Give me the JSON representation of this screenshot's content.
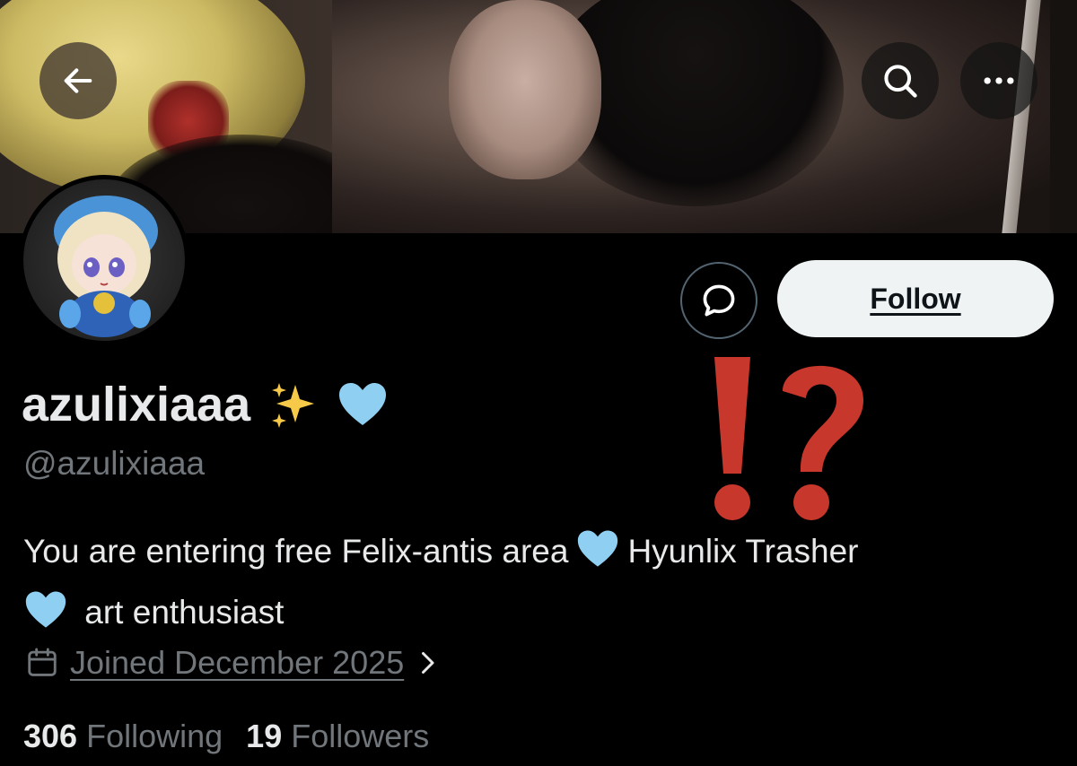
{
  "header": {
    "back_icon": "arrow-left-icon",
    "search_icon": "search-icon",
    "more_icon": "more-horizontal-icon"
  },
  "profile": {
    "display_name": "azulixiaaa",
    "name_emojis": [
      "sparkles-emoji",
      "blue-heart-emoji"
    ],
    "handle": "@azulixiaaa",
    "bio_line1_part1": "You are entering free Felix-antis area",
    "bio_line1_part2": "Hyunlix Trasher",
    "bio_line2": "art enthusiast",
    "joined": "Joined December 2025",
    "following_count": "306",
    "following_label": "Following",
    "followers_count": "19",
    "followers_label": "Followers"
  },
  "actions": {
    "message_icon": "message-bubble-icon",
    "follow_label": "Follow"
  },
  "overlay": {
    "sticker": "⁉",
    "sticker_color": "#c8372b"
  },
  "colors": {
    "background": "#000000",
    "primary_text": "#e7e9ea",
    "secondary_text": "#71767b",
    "follow_bg": "#eff3f4",
    "heart_blue": "#8fd0f2"
  }
}
